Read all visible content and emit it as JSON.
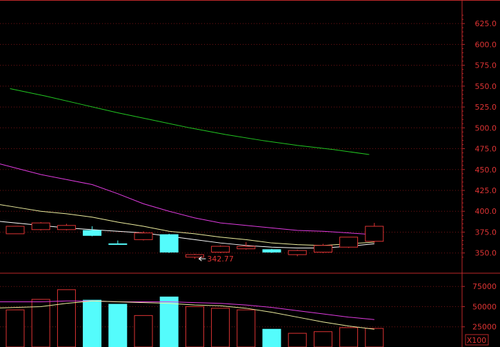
{
  "colors": {
    "background": "#000000",
    "axis": "#c0282a",
    "grid": "#7a1416",
    "up_candle": "#e03434",
    "down_candle": "#54fcfc",
    "ma_long": "#22c822",
    "ma_mid": "#e23ce2",
    "ma_short": "#f0f0a0",
    "ma_short_white": "#ffffff",
    "vol_ma_fast": "#f0f0a0",
    "vol_ma_slow": "#e23ce2"
  },
  "chart_data": [
    {
      "type": "candlestick",
      "title": "",
      "y_ticks": [
        350.0,
        375.0,
        400.0,
        425.0,
        450.0,
        475.0,
        500.0,
        525.0,
        550.0,
        575.0,
        600.0,
        625.0
      ],
      "y_tick_labels": [
        "350.0",
        "375.0",
        "400.0",
        "425.0",
        "450.0",
        "475.0",
        "500.0",
        "525.0",
        "550.0",
        "575.0",
        "600.0",
        "625.0"
      ],
      "ylim": [
        339,
        640
      ],
      "grid": true,
      "candles": [
        {
          "open": 373,
          "close": 382,
          "high": 382,
          "low": 373,
          "dir": "up"
        },
        {
          "open": 378,
          "close": 386,
          "high": 387,
          "low": 377,
          "dir": "up"
        },
        {
          "open": 378,
          "close": 383,
          "high": 385,
          "low": 377,
          "dir": "up"
        },
        {
          "open": 377,
          "close": 371,
          "high": 382,
          "low": 370,
          "dir": "down"
        },
        {
          "open": 361,
          "close": 361,
          "high": 365,
          "low": 360,
          "dir": "down"
        },
        {
          "open": 366,
          "close": 374,
          "high": 376,
          "low": 365,
          "dir": "up"
        },
        {
          "open": 372,
          "close": 351,
          "high": 373,
          "low": 350,
          "dir": "down"
        },
        {
          "open": 345,
          "close": 348,
          "high": 349,
          "low": 343,
          "dir": "up"
        },
        {
          "open": 351,
          "close": 358,
          "high": 359,
          "low": 350,
          "dir": "up"
        },
        {
          "open": 355,
          "close": 358,
          "high": 363,
          "low": 354,
          "dir": "up"
        },
        {
          "open": 354,
          "close": 351,
          "high": 355,
          "low": 350,
          "dir": "down"
        },
        {
          "open": 348,
          "close": 353,
          "high": 354,
          "low": 346,
          "dir": "up"
        },
        {
          "open": 351,
          "close": 359,
          "high": 361,
          "low": 350,
          "dir": "up"
        },
        {
          "open": 357,
          "close": 369,
          "high": 369,
          "low": 356,
          "dir": "up"
        },
        {
          "open": 364,
          "close": 382,
          "high": 386,
          "low": 362,
          "dir": "up"
        }
      ],
      "ma_long": [
        547,
        538,
        528,
        518,
        509,
        500,
        492,
        485,
        479,
        474,
        468
      ],
      "ma_long_x": [
        -0.2,
        1.2,
        2.6,
        4.0,
        5.4,
        6.8,
        8.2,
        9.6,
        11.0,
        12.4,
        13.8
      ],
      "ma_mid": [
        452,
        444,
        438,
        432,
        421,
        409,
        400,
        392,
        386,
        383,
        380,
        377,
        376,
        374,
        372
      ],
      "ma_short": [
        405,
        400,
        397,
        393,
        387,
        382,
        376,
        373,
        369,
        366,
        362,
        360,
        359,
        361,
        363
      ],
      "ma_short_white": [
        386,
        383,
        380,
        378,
        376,
        374,
        370,
        366,
        362,
        359,
        357,
        356,
        356,
        358,
        361
      ],
      "annotations": [
        {
          "text": "342.77",
          "candle_index": 7,
          "value": 343
        }
      ]
    },
    {
      "type": "bar",
      "title": "",
      "unit_label": "X100",
      "y_ticks": [
        25000,
        50000,
        75000
      ],
      "y_tick_labels": [
        "25000",
        "50000",
        "75000"
      ],
      "ylim": [
        0,
        88000
      ],
      "grid": true,
      "values": [
        46000,
        59000,
        71000,
        58000,
        53000,
        39000,
        62000,
        50000,
        48000,
        46000,
        22000,
        17000,
        19000,
        24000,
        23000
      ],
      "dirs": [
        "up",
        "up",
        "up",
        "down",
        "down",
        "up",
        "down",
        "up",
        "up",
        "up",
        "down",
        "up",
        "up",
        "up",
        "up"
      ],
      "ma_fast": [
        49000,
        50000,
        54000,
        57000,
        56000,
        55000,
        54000,
        52000,
        51000,
        48000,
        43000,
        37000,
        31000,
        26000,
        22000
      ],
      "ma_slow": [
        56000,
        56000,
        57000,
        57000,
        56000,
        56000,
        56000,
        55000,
        54000,
        52000,
        49000,
        45000,
        41000,
        37000,
        34000
      ]
    }
  ]
}
